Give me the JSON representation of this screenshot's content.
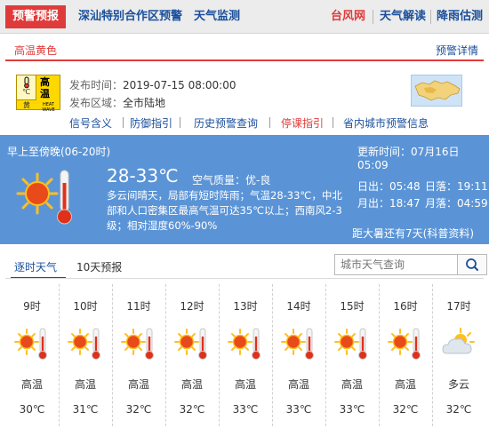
{
  "topnav": {
    "active_tab": "预警预报",
    "tabs": [
      "深汕特别合作区预警",
      "天气监测"
    ],
    "right_tabs": [
      "台风网",
      "天气解读",
      "降雨估测"
    ]
  },
  "warning": {
    "title": "高温黄色",
    "detail_link": "预警详情",
    "icon": {
      "char": "高温",
      "level": "黄",
      "en": "HEAT WAVE",
      "unit": "℃"
    },
    "publish_time_label": "发布时间：",
    "publish_time": "2019-07-15 08:00:00",
    "area_label": "发布区域：",
    "area": "全市陆地",
    "links": [
      "信号含义",
      "防御指引",
      "历史预警查询",
      "停课指引",
      "省内城市预警信息"
    ]
  },
  "weather": {
    "period": "早上至傍晚(06-20时)",
    "update_label": "更新时间：",
    "update_time": "07月16日 05:09",
    "temperature": "28-33℃",
    "air_quality_label": "空气质量：",
    "air_quality": "优-良",
    "description": "多云间晴天，局部有短时阵雨；气温28-33℃，中北部和人口密集区最高气温可达35℃以上；西南风2-3级；相对湿度60%-90%",
    "sunrise_label": "日出：",
    "sunrise": "05:48",
    "sunset_label": "日落：",
    "sunset": "19:11",
    "moonrise_label": "月出：",
    "moonrise": "18:47",
    "moonset_label": "月落：",
    "moonset": "04:59",
    "solar_term": "距大暑还有7天(科普资料)"
  },
  "forecast_tabs": {
    "hourly_label": "逐时天气",
    "tenday_label": "10天预报"
  },
  "search": {
    "placeholder": "城市天气查询"
  },
  "hourly": [
    {
      "hour": "9时",
      "condition": "高温",
      "temp": "30℃",
      "icon": "sun-thermometer-icon"
    },
    {
      "hour": "10时",
      "condition": "高温",
      "temp": "31℃",
      "icon": "sun-thermometer-icon"
    },
    {
      "hour": "11时",
      "condition": "高温",
      "temp": "32℃",
      "icon": "sun-thermometer-icon"
    },
    {
      "hour": "12时",
      "condition": "高温",
      "temp": "32℃",
      "icon": "sun-thermometer-icon"
    },
    {
      "hour": "13时",
      "condition": "高温",
      "temp": "33℃",
      "icon": "sun-thermometer-icon"
    },
    {
      "hour": "14时",
      "condition": "高温",
      "temp": "33℃",
      "icon": "sun-thermometer-icon"
    },
    {
      "hour": "15时",
      "condition": "高温",
      "temp": "33℃",
      "icon": "sun-thermometer-icon"
    },
    {
      "hour": "16时",
      "condition": "高温",
      "temp": "32℃",
      "icon": "sun-thermometer-icon"
    },
    {
      "hour": "17时",
      "condition": "多云",
      "temp": "32℃",
      "icon": "partly-cloudy-icon"
    }
  ],
  "colors": {
    "accent_red": "#e03b3b",
    "link_blue": "#1a4f9c",
    "panel_blue": "#5b94d6",
    "warning_yellow": "#ffd800"
  }
}
